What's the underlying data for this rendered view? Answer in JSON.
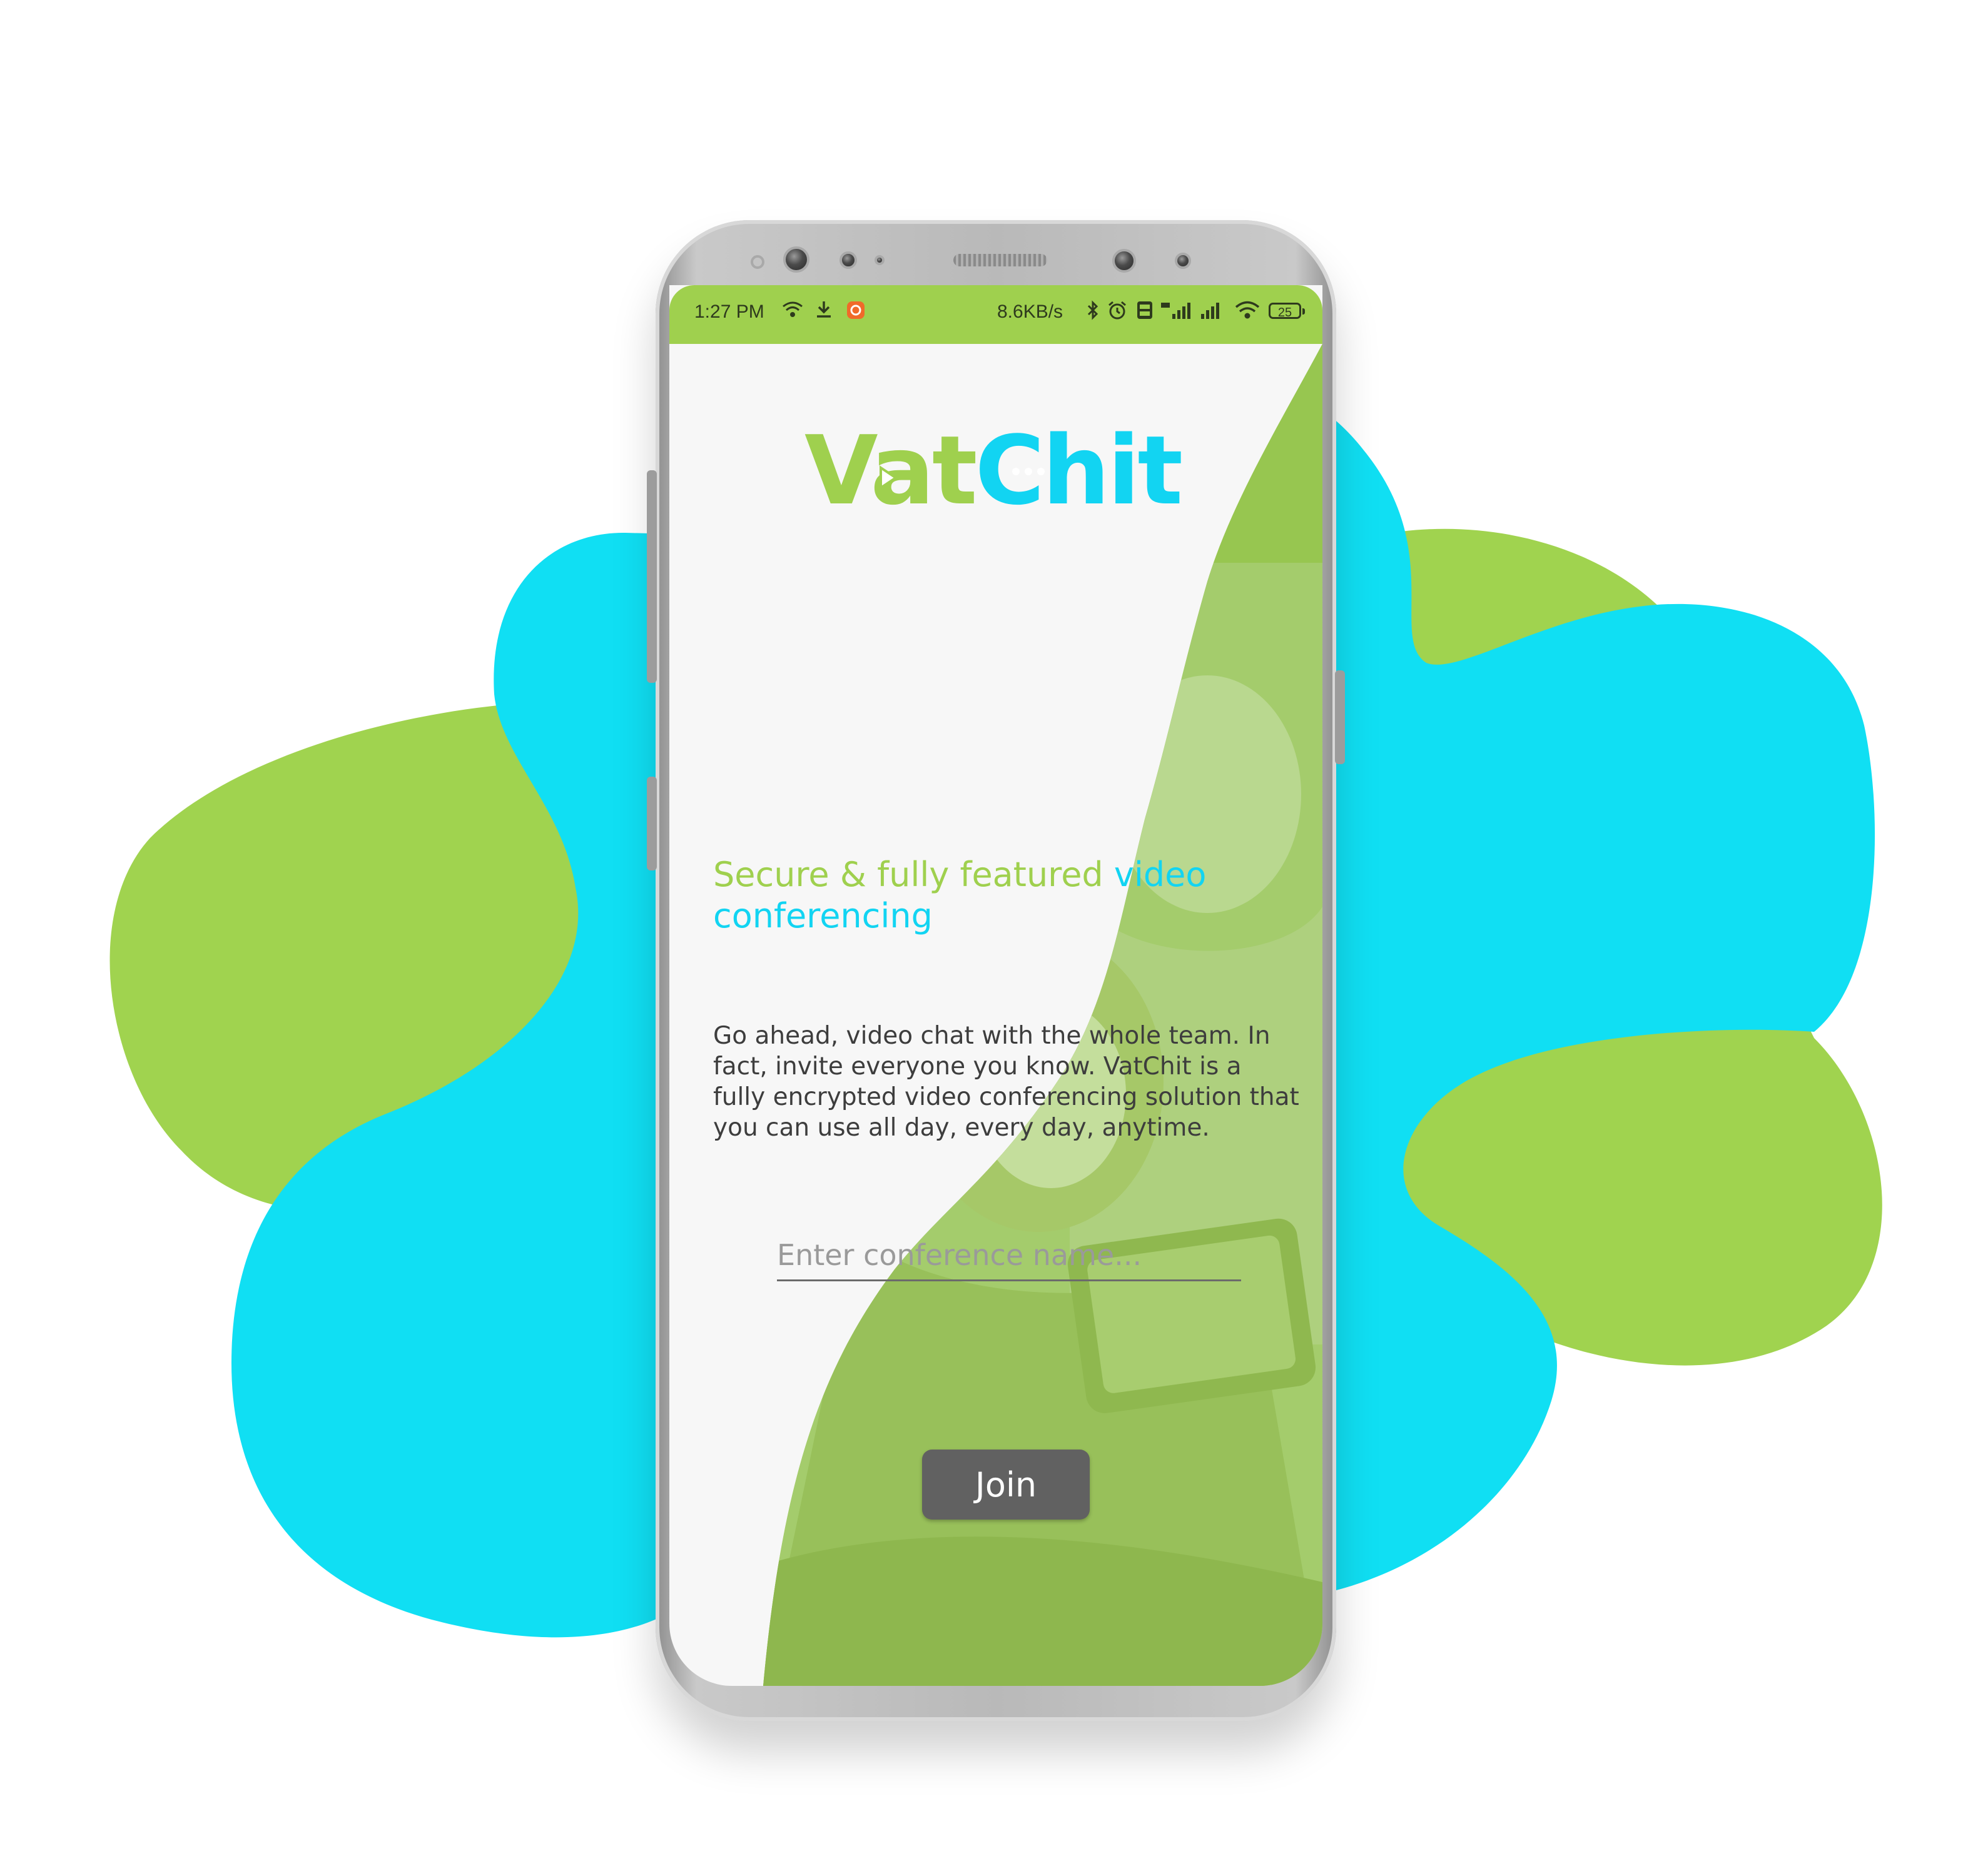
{
  "status_bar": {
    "time": "1:27 PM",
    "network_speed": "8.6KB/s",
    "battery_level": "25",
    "icons": [
      "wifi-icon",
      "download-icon",
      "app-notification-icon",
      "bluetooth-icon",
      "alarm-icon",
      "volte-icon",
      "signal-icon",
      "signal-icon",
      "wifi-icon",
      "battery-icon"
    ]
  },
  "app": {
    "logo": {
      "part1": "Va",
      "part2": "t",
      "part3": "Chit"
    },
    "headline": {
      "green": "Secure & fully featured ",
      "blue": "video conferencing"
    },
    "description": "Go ahead, video chat with the whole team. In fact, invite everyone you know. VatChit is a fully encrypted video conferencing solution that you can use all day, every day, anytime.",
    "conference_input": {
      "placeholder": "Enter conference name...",
      "value": ""
    },
    "join_label": "Join"
  },
  "colors": {
    "brand_green": "#9fd04e",
    "brand_blue": "#12d4f2",
    "button_gray": "#616161",
    "screen_bg": "#f7f7f7"
  }
}
